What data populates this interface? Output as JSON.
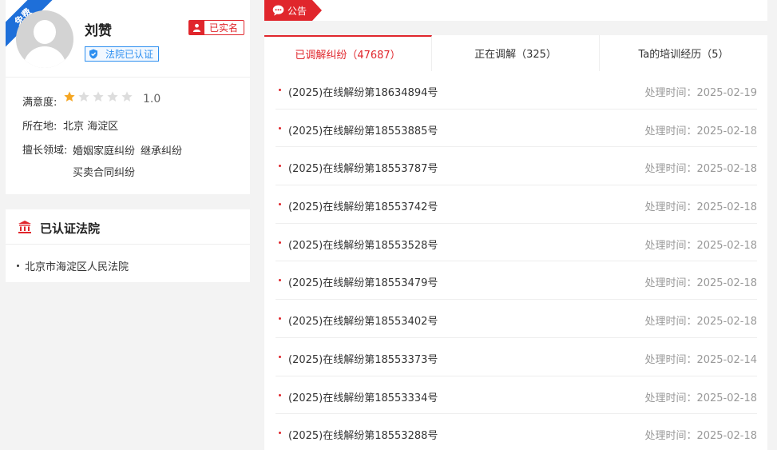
{
  "profile": {
    "ribbon_label": "免费",
    "name": "刘赞",
    "realname_badge": "已实名",
    "court_badge": "法院已认证",
    "satisfaction_label": "满意度:",
    "rating": 1.0,
    "rating_text": "1.0",
    "rating_max": 5,
    "location_label": "所在地:",
    "location_value": "北京 海淀区",
    "specialty_label": "擅长领域:",
    "specialties": [
      "婚姻家庭纠纷",
      "继承纠纷",
      "买卖合同纠纷"
    ]
  },
  "courts": {
    "title": "已认证法院",
    "items": [
      "北京市海淀区人民法院"
    ]
  },
  "notice": {
    "tag_label": "公告"
  },
  "tabs": [
    {
      "label": "已调解纠纷（47687）",
      "active": true
    },
    {
      "label": "正在调解（325）",
      "active": false
    },
    {
      "label": "Ta的培训经历（5）",
      "active": false
    }
  ],
  "cases": [
    {
      "title": "(2025)在线解纷第18634894号",
      "time": "处理时间：2025-02-19"
    },
    {
      "title": "(2025)在线解纷第18553885号",
      "time": "处理时间：2025-02-18"
    },
    {
      "title": "(2025)在线解纷第18553787号",
      "time": "处理时间：2025-02-18"
    },
    {
      "title": "(2025)在线解纷第18553742号",
      "time": "处理时间：2025-02-18"
    },
    {
      "title": "(2025)在线解纷第18553528号",
      "time": "处理时间：2025-02-18"
    },
    {
      "title": "(2025)在线解纷第18553479号",
      "time": "处理时间：2025-02-18"
    },
    {
      "title": "(2025)在线解纷第18553402号",
      "time": "处理时间：2025-02-18"
    },
    {
      "title": "(2025)在线解纷第18553373号",
      "time": "处理时间：2025-02-14"
    },
    {
      "title": "(2025)在线解纷第18553334号",
      "time": "处理时间：2025-02-18"
    },
    {
      "title": "(2025)在线解纷第18553288号",
      "time": "处理时间：2025-02-18"
    }
  ],
  "colors": {
    "accent_red": "#e0262c",
    "accent_blue": "#2d8ff0",
    "ribbon_blue": "#1e6fd9",
    "star_filled": "#f5a623",
    "star_empty": "#dddddd"
  }
}
